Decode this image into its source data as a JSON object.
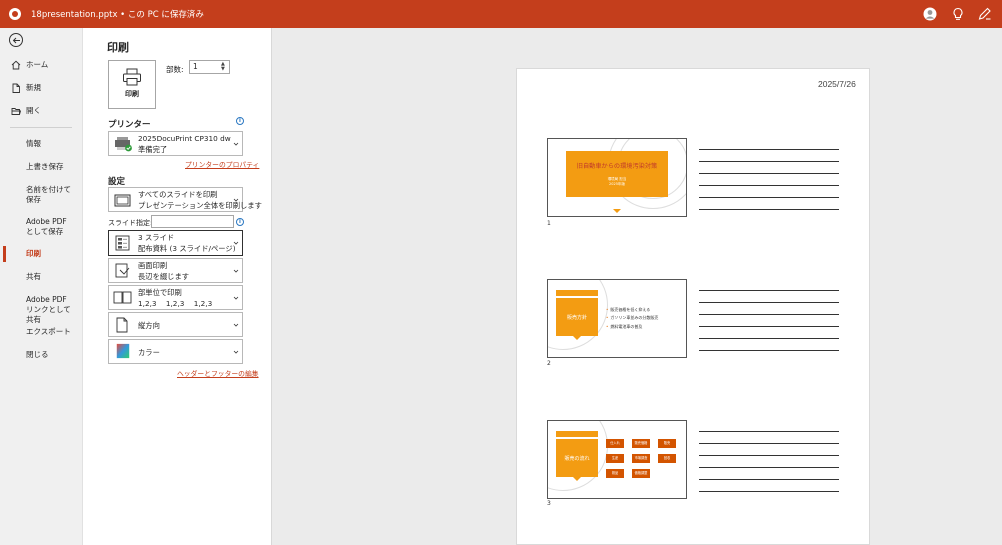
{
  "titlebar": {
    "title": "18presentation.pptx • この PC に保存済み",
    "icons": [
      "user-avatar-icon",
      "lightbulb-icon",
      "feedback-icon"
    ]
  },
  "sidebar": {
    "items": [
      {
        "label": "ホーム",
        "icon": "home-icon"
      },
      {
        "label": "新規",
        "icon": "new-file-icon"
      },
      {
        "label": "開く",
        "icon": "folder-open-icon"
      },
      {
        "label": "情報"
      },
      {
        "label": "上書き保存"
      },
      {
        "label": "名前を付けて保存"
      },
      {
        "label": "Adobe PDF として保存"
      },
      {
        "label": "印刷",
        "active": true
      },
      {
        "label": "共有"
      },
      {
        "label": "Adobe PDF リンクとして共有"
      },
      {
        "label": "エクスポート"
      },
      {
        "label": "閉じる"
      }
    ]
  },
  "print": {
    "heading": "印刷",
    "button_label": "印刷",
    "copies_label": "部数:",
    "copies_value": "1"
  },
  "printer": {
    "heading": "プリンター",
    "name": "2025DocuPrint CP310 dw",
    "status": "準備完了",
    "properties_link": "プリンターのプロパティ"
  },
  "settings": {
    "heading": "設定",
    "slides_label": "スライド指定:",
    "slides_value": "",
    "options": [
      {
        "line1": "すべてのスライドを印刷",
        "line2": "プレゼンテーション全体を印刷します",
        "icon": "slides-icon"
      },
      {
        "line1": "3 スライド",
        "line2": "配布資料 (3 スライド/ページ)",
        "icon": "handout-icon",
        "selected": true
      },
      {
        "line1": "画面印刷",
        "line2": "長辺を綴じます",
        "icon": "print-side-icon"
      },
      {
        "line1": "部単位で印刷",
        "line2": "1,2,3    1,2,3    1,2,3",
        "icon": "collate-icon"
      },
      {
        "line1": "縦方向",
        "line2": "",
        "icon": "portrait-icon"
      },
      {
        "line1": "カラー",
        "line2": "",
        "icon": "color-icon"
      }
    ],
    "header_footer_link": "ヘッダーとフッターの編集"
  },
  "preview": {
    "date": "2025/7/26",
    "slides": [
      {
        "number": "1",
        "title": "旧自動車からの環境汚染対策",
        "subtitle_lines": [
          "環境局 担当",
          "2025年版"
        ]
      },
      {
        "number": "2",
        "banner": "販売方針",
        "bullets": [
          "販売価格を低く抑える",
          "ガソリン車並みの分散販売",
          "燃料電池車の普及"
        ]
      },
      {
        "number": "3",
        "banner": "販売の流れ",
        "flow": [
          "仕入れ",
          "販売価格",
          "販売",
          "生産",
          "市場調査",
          "回収",
          "検品",
          "価格調整"
        ]
      }
    ]
  },
  "colors": {
    "accent": "#c43e1c",
    "slide_orange": "#f39c12"
  }
}
